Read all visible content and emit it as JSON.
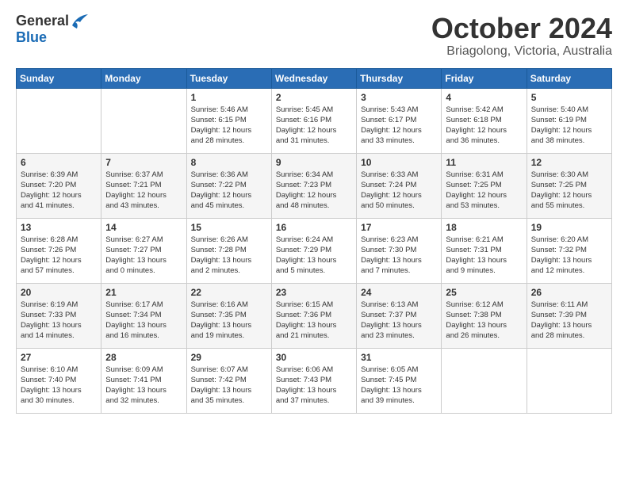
{
  "header": {
    "logo_general": "General",
    "logo_blue": "Blue",
    "month_title": "October 2024",
    "location": "Briagolong, Victoria, Australia"
  },
  "weekdays": [
    "Sunday",
    "Monday",
    "Tuesday",
    "Wednesday",
    "Thursday",
    "Friday",
    "Saturday"
  ],
  "weeks": [
    [
      {
        "day": "",
        "info": ""
      },
      {
        "day": "",
        "info": ""
      },
      {
        "day": "1",
        "info": "Sunrise: 5:46 AM\nSunset: 6:15 PM\nDaylight: 12 hours\nand 28 minutes."
      },
      {
        "day": "2",
        "info": "Sunrise: 5:45 AM\nSunset: 6:16 PM\nDaylight: 12 hours\nand 31 minutes."
      },
      {
        "day": "3",
        "info": "Sunrise: 5:43 AM\nSunset: 6:17 PM\nDaylight: 12 hours\nand 33 minutes."
      },
      {
        "day": "4",
        "info": "Sunrise: 5:42 AM\nSunset: 6:18 PM\nDaylight: 12 hours\nand 36 minutes."
      },
      {
        "day": "5",
        "info": "Sunrise: 5:40 AM\nSunset: 6:19 PM\nDaylight: 12 hours\nand 38 minutes."
      }
    ],
    [
      {
        "day": "6",
        "info": "Sunrise: 6:39 AM\nSunset: 7:20 PM\nDaylight: 12 hours\nand 41 minutes."
      },
      {
        "day": "7",
        "info": "Sunrise: 6:37 AM\nSunset: 7:21 PM\nDaylight: 12 hours\nand 43 minutes."
      },
      {
        "day": "8",
        "info": "Sunrise: 6:36 AM\nSunset: 7:22 PM\nDaylight: 12 hours\nand 45 minutes."
      },
      {
        "day": "9",
        "info": "Sunrise: 6:34 AM\nSunset: 7:23 PM\nDaylight: 12 hours\nand 48 minutes."
      },
      {
        "day": "10",
        "info": "Sunrise: 6:33 AM\nSunset: 7:24 PM\nDaylight: 12 hours\nand 50 minutes."
      },
      {
        "day": "11",
        "info": "Sunrise: 6:31 AM\nSunset: 7:25 PM\nDaylight: 12 hours\nand 53 minutes."
      },
      {
        "day": "12",
        "info": "Sunrise: 6:30 AM\nSunset: 7:25 PM\nDaylight: 12 hours\nand 55 minutes."
      }
    ],
    [
      {
        "day": "13",
        "info": "Sunrise: 6:28 AM\nSunset: 7:26 PM\nDaylight: 12 hours\nand 57 minutes."
      },
      {
        "day": "14",
        "info": "Sunrise: 6:27 AM\nSunset: 7:27 PM\nDaylight: 13 hours\nand 0 minutes."
      },
      {
        "day": "15",
        "info": "Sunrise: 6:26 AM\nSunset: 7:28 PM\nDaylight: 13 hours\nand 2 minutes."
      },
      {
        "day": "16",
        "info": "Sunrise: 6:24 AM\nSunset: 7:29 PM\nDaylight: 13 hours\nand 5 minutes."
      },
      {
        "day": "17",
        "info": "Sunrise: 6:23 AM\nSunset: 7:30 PM\nDaylight: 13 hours\nand 7 minutes."
      },
      {
        "day": "18",
        "info": "Sunrise: 6:21 AM\nSunset: 7:31 PM\nDaylight: 13 hours\nand 9 minutes."
      },
      {
        "day": "19",
        "info": "Sunrise: 6:20 AM\nSunset: 7:32 PM\nDaylight: 13 hours\nand 12 minutes."
      }
    ],
    [
      {
        "day": "20",
        "info": "Sunrise: 6:19 AM\nSunset: 7:33 PM\nDaylight: 13 hours\nand 14 minutes."
      },
      {
        "day": "21",
        "info": "Sunrise: 6:17 AM\nSunset: 7:34 PM\nDaylight: 13 hours\nand 16 minutes."
      },
      {
        "day": "22",
        "info": "Sunrise: 6:16 AM\nSunset: 7:35 PM\nDaylight: 13 hours\nand 19 minutes."
      },
      {
        "day": "23",
        "info": "Sunrise: 6:15 AM\nSunset: 7:36 PM\nDaylight: 13 hours\nand 21 minutes."
      },
      {
        "day": "24",
        "info": "Sunrise: 6:13 AM\nSunset: 7:37 PM\nDaylight: 13 hours\nand 23 minutes."
      },
      {
        "day": "25",
        "info": "Sunrise: 6:12 AM\nSunset: 7:38 PM\nDaylight: 13 hours\nand 26 minutes."
      },
      {
        "day": "26",
        "info": "Sunrise: 6:11 AM\nSunset: 7:39 PM\nDaylight: 13 hours\nand 28 minutes."
      }
    ],
    [
      {
        "day": "27",
        "info": "Sunrise: 6:10 AM\nSunset: 7:40 PM\nDaylight: 13 hours\nand 30 minutes."
      },
      {
        "day": "28",
        "info": "Sunrise: 6:09 AM\nSunset: 7:41 PM\nDaylight: 13 hours\nand 32 minutes."
      },
      {
        "day": "29",
        "info": "Sunrise: 6:07 AM\nSunset: 7:42 PM\nDaylight: 13 hours\nand 35 minutes."
      },
      {
        "day": "30",
        "info": "Sunrise: 6:06 AM\nSunset: 7:43 PM\nDaylight: 13 hours\nand 37 minutes."
      },
      {
        "day": "31",
        "info": "Sunrise: 6:05 AM\nSunset: 7:45 PM\nDaylight: 13 hours\nand 39 minutes."
      },
      {
        "day": "",
        "info": ""
      },
      {
        "day": "",
        "info": ""
      }
    ]
  ]
}
